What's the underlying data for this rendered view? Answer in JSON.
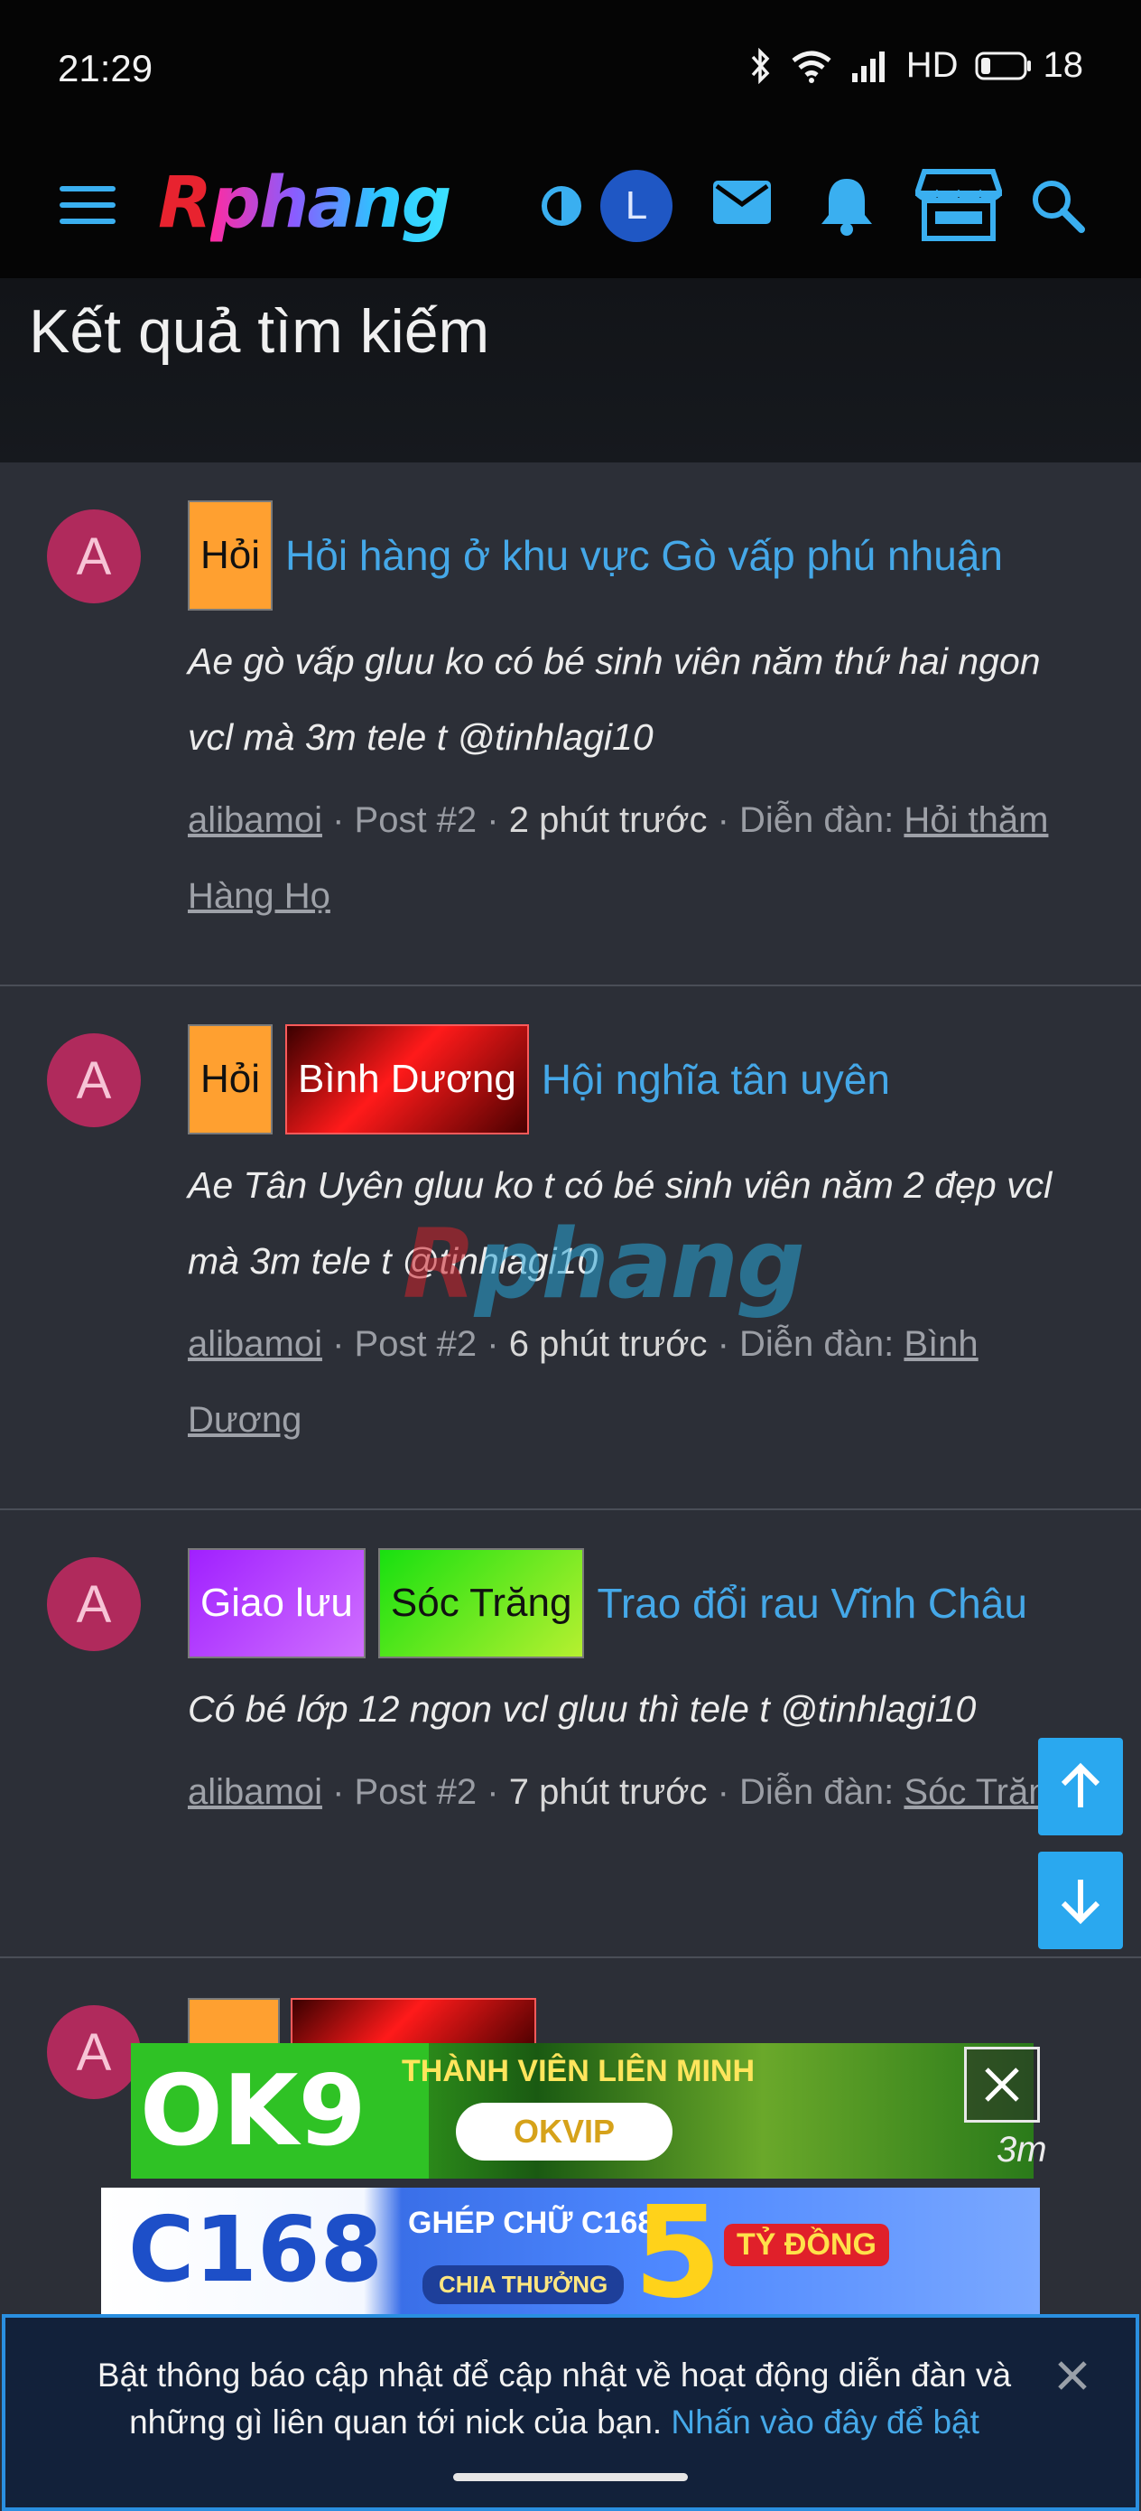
{
  "status_bar": {
    "time": "21:29",
    "network": "HD",
    "battery": "18"
  },
  "header": {
    "logo_first": "R",
    "logo_rest": "phang",
    "user_initial": "L",
    "icons": [
      "menu-icon",
      "theme-toggle-icon",
      "mail-icon",
      "bell-icon",
      "store-icon",
      "search-icon"
    ],
    "accent_color": "#45a8e8"
  },
  "page": {
    "title": "Kết quả tìm kiếm"
  },
  "results": [
    {
      "avatar": "A",
      "tags": [
        {
          "label": "Hỏi",
          "style": "hoi"
        }
      ],
      "title": "Hỏi hàng ở khu vực Gò vấp phú nhuận",
      "snippet": "Ae gò vấp gluu ko có bé sinh viên năm thứ hai ngon vcl mà 3m tele t @tinhlagi10",
      "author": "alibamoi",
      "post": "Post #2",
      "time": "2 phút trước",
      "forum_label": "Diễn đàn:",
      "forum": "Hỏi thăm Hàng Họ"
    },
    {
      "avatar": "A",
      "tags": [
        {
          "label": "Hỏi",
          "style": "hoi"
        },
        {
          "label": "Bình Dương",
          "style": "bd"
        }
      ],
      "title": "Hội nghĩa tân uyên",
      "snippet": "Ae Tân Uyên gluu ko t có bé sinh viên năm 2 đẹp vcl mà 3m tele t @tinhlagi10",
      "author": "alibamoi",
      "post": "Post #2",
      "time": "6 phút trước",
      "forum_label": "Diễn đàn:",
      "forum": "Bình Dương"
    },
    {
      "avatar": "A",
      "tags": [
        {
          "label": "Giao lưu",
          "style": "gl"
        },
        {
          "label": "Sóc Trăng",
          "style": "st"
        }
      ],
      "title": "Trao đổi rau Vĩnh Châu",
      "snippet": "Có bé lớp 12 ngon vcl gluu thì tele t @tinhlagi10",
      "author": "alibamoi",
      "post": "Post #2",
      "time": "7 phút trước",
      "forum_label": "Diễn đàn:",
      "forum": "Sóc Trăng"
    },
    {
      "avatar": "A",
      "trailing_text": "3m"
    }
  ],
  "watermark": {
    "first": "R",
    "rest": "phang"
  },
  "ads": {
    "ad1_brand": "OK9",
    "ad1_tagline": "THÀNH VIÊN LIÊN MINH",
    "ad1_badge": "OKVIP",
    "ad2_brand": "C168",
    "ad2_tagline": "GHÉP CHỮ C168",
    "ad2_sub": "CHIA THƯỞNG",
    "ad2_amount": "5",
    "ad2_unit": "TỶ ĐỒNG"
  },
  "notification": {
    "text": "Bật thông báo cập nhật để cập nhật về hoạt động diễn đàn và những gì liên quan tới nick của bạn.",
    "link": "Nhấn vào đây để bật"
  }
}
